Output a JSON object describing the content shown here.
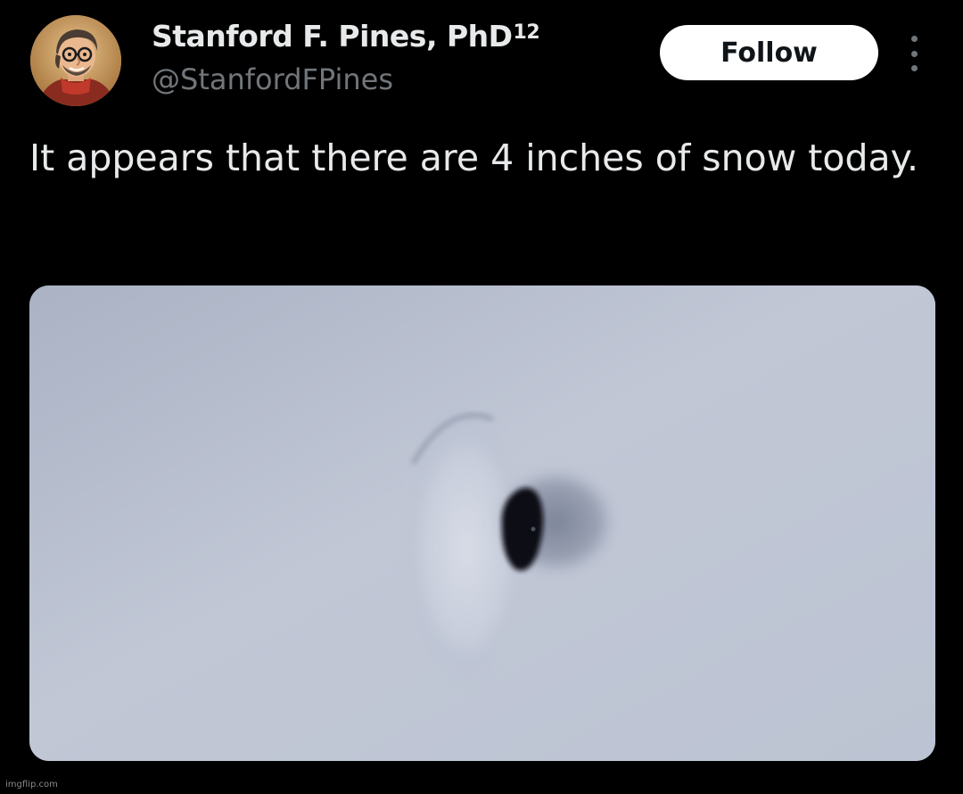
{
  "author": {
    "display_name": "Stanford F. Pines, PhD",
    "superscript": "12",
    "handle": "@StanfordFPines"
  },
  "actions": {
    "follow_label": "Follow",
    "more_icon": "vertical-ellipsis"
  },
  "tweet": {
    "text": "It appears that there are 4 inches of snow today."
  },
  "media": {
    "icon": "snow-photo"
  },
  "watermark": {
    "text": "imgflip.com"
  },
  "colors": {
    "background": "#000000",
    "primary_text": "#e7e9ea",
    "secondary_text": "#71767b",
    "follow_bg": "#ffffff",
    "follow_text": "#0f1419"
  }
}
